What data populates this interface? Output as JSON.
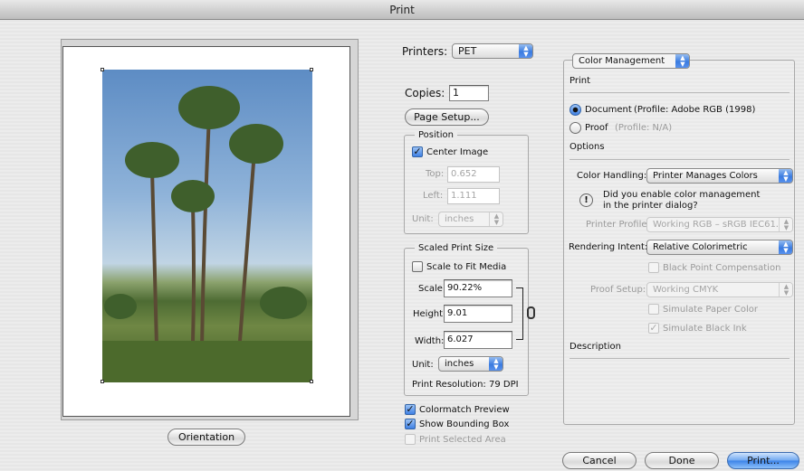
{
  "window": {
    "title": "Print"
  },
  "left": {
    "orientation_label": "Orientation"
  },
  "middle": {
    "printers_label": "Printers:",
    "printers_value": "PET",
    "copies_label": "Copies:",
    "copies_value": "1",
    "page_setup_label": "Page Setup...",
    "position": {
      "legend": "Position",
      "center_image_label": "Center Image",
      "center_image_checked": true,
      "top_label": "Top:",
      "top_value": "0.652",
      "left_label": "Left:",
      "left_value": "1.111",
      "unit_label": "Unit:",
      "unit_value": "inches"
    },
    "scaled": {
      "legend": "Scaled Print Size",
      "scale_to_fit_label": "Scale to Fit Media",
      "scale_to_fit_checked": false,
      "scale_label": "Scale:",
      "scale_value": "90.22%",
      "height_label": "Height:",
      "height_value": "9.01",
      "width_label": "Width:",
      "width_value": "6.027",
      "unit_label": "Unit:",
      "unit_value": "inches",
      "resolution": "Print Resolution: 79 DPI"
    },
    "colormatch_label": "Colormatch Preview",
    "colormatch_checked": true,
    "show_bbox_label": "Show Bounding Box",
    "show_bbox_checked": true,
    "print_selected_label": "Print Selected Area",
    "print_selected_checked": false
  },
  "right": {
    "section_value": "Color Management",
    "print_heading": "Print",
    "document_label": "Document",
    "document_profile": "(Profile: Adobe RGB (1998)",
    "proof_label": "Proof",
    "proof_profile": "(Profile: N/A)",
    "options_heading": "Options",
    "color_handling_label": "Color Handling:",
    "color_handling_value": "Printer Manages Colors",
    "warning_line1": "Did you enable color management",
    "warning_line2": "in the printer dialog?",
    "printer_profile_label": "Printer Profile:",
    "printer_profile_value": "Working RGB – sRGB IEC61...",
    "rendering_intent_label": "Rendering Intent:",
    "rendering_intent_value": "Relative Colorimetric",
    "black_point_label": "Black Point Compensation",
    "proof_setup_label": "Proof Setup:",
    "proof_setup_value": "Working CMYK",
    "simulate_paper_label": "Simulate Paper Color",
    "simulate_black_label": "Simulate Black Ink",
    "description_heading": "Description"
  },
  "buttons": {
    "cancel": "Cancel",
    "done": "Done",
    "print": "Print..."
  },
  "colors": {
    "accent": "#3b82e8",
    "window_bg": "#ececec"
  }
}
